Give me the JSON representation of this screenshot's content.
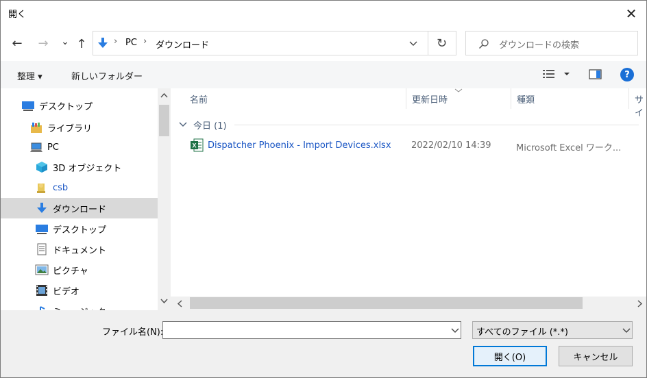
{
  "window": {
    "title": "開く",
    "close_glyph": "✕"
  },
  "nav": {
    "back_glyph": "←",
    "forward_glyph": "→",
    "recent_glyph": "⌄",
    "up_glyph": "↑",
    "breadcrumb": [
      "PC",
      "ダウンロード"
    ],
    "separator": "›",
    "refresh_glyph": "↻",
    "search_placeholder": "ダウンロードの検索"
  },
  "toolbar": {
    "organize_label": "整理 ▾",
    "new_folder_label": "新しいフォルダー",
    "help_label": "?"
  },
  "tree": {
    "items": [
      {
        "label": "デスクトップ",
        "icon": "desktop-icon"
      },
      {
        "label": "ライブラリ",
        "icon": "library-icon"
      },
      {
        "label": "PC",
        "icon": "pc-icon"
      },
      {
        "label": "3D オブジェクト",
        "icon": "3d-objects-icon"
      },
      {
        "label": "csb",
        "icon": "user-folder-icon"
      },
      {
        "label": "ダウンロード",
        "icon": "download-icon"
      },
      {
        "label": "デスクトップ",
        "icon": "desktop-icon"
      },
      {
        "label": "ドキュメント",
        "icon": "document-icon"
      },
      {
        "label": "ピクチャ",
        "icon": "pictures-icon"
      },
      {
        "label": "ビデオ",
        "icon": "video-icon"
      },
      {
        "label": "ミュージック",
        "icon": "music-icon"
      }
    ],
    "selected_index": 5
  },
  "list": {
    "columns": [
      "名前",
      "更新日時",
      "種類",
      "サイ"
    ],
    "group_label": "今日 (1)",
    "files": [
      {
        "name": "Dispatcher Phoenix - Import Devices.xlsx",
        "modified": "2022/02/10 14:39",
        "type": "Microsoft Excel ワーク...",
        "icon": "excel-file-icon"
      }
    ]
  },
  "bottom": {
    "filename_label": "ファイル名(N):",
    "filename_value": "",
    "filetype_value": "すべてのファイル (*.*)",
    "open_label": "開く(O)",
    "cancel_label": "キャンセル"
  },
  "colors": {
    "accent": "#0078d7",
    "link": "#1a56c4",
    "selected_bg": "#d9d9d9",
    "excel_green": "#1e7145"
  }
}
